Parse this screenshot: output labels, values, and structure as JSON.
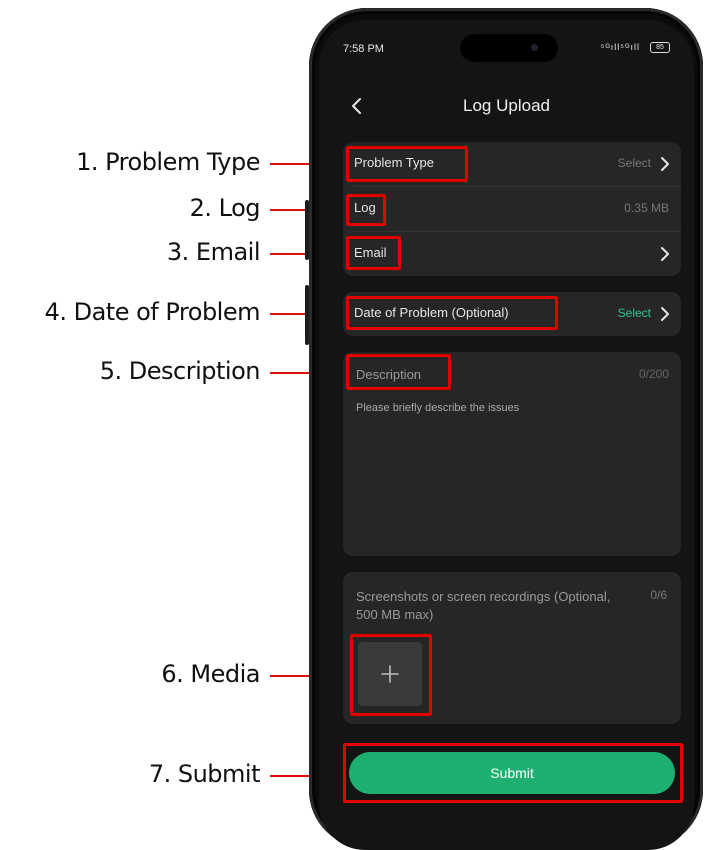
{
  "callouts": [
    "1. Problem Type",
    "2. Log",
    "3. Email",
    "4. Date of Problem",
    "5. Description",
    "6. Media",
    "7. Submit"
  ],
  "status_bar": {
    "time": "7:58 PM",
    "signal": "⁵ᴳıll⁵ᴳıll",
    "battery": "85"
  },
  "header": {
    "title": "Log Upload",
    "back_icon": "chevron-left-icon"
  },
  "form": {
    "problem_type": {
      "label": "Problem Type",
      "value": "Select"
    },
    "log": {
      "label": "Log",
      "value": "0.35 MB"
    },
    "email": {
      "label": "Email",
      "value": ""
    },
    "date_of_problem": {
      "label": "Date of Problem (Optional)",
      "value": "Select"
    },
    "description": {
      "label": "Description",
      "count": "0/200",
      "placeholder": "Please briefly describe the issues"
    },
    "media": {
      "label": "Screenshots or screen recordings (Optional, 500 MB max)",
      "count": "0/6",
      "add_icon": "plus-icon"
    },
    "submit_label": "Submit"
  },
  "colors": {
    "accent_green": "#1eb070",
    "select_green": "#35c58e",
    "annotation_red": "#e00000",
    "screen_bg": "#141414",
    "card_bg": "#262626"
  }
}
